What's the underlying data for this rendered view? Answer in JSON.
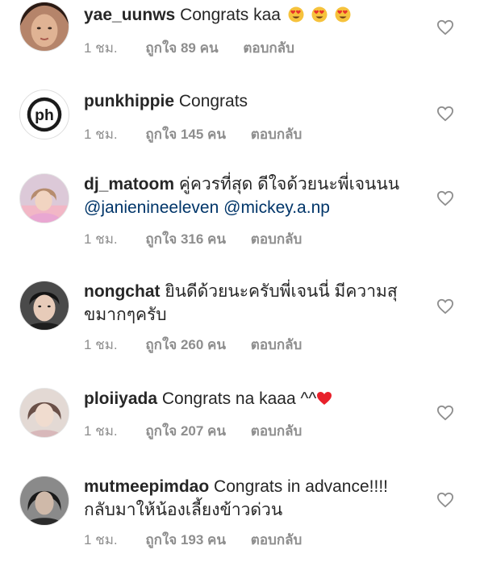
{
  "comments": [
    {
      "username": "yae_uunws",
      "text": "Congrats kaa",
      "emoji": [
        "heart-eyes-emoji",
        "heart-eyes-emoji",
        "heart-eyes-emoji"
      ],
      "time": "1 ชม.",
      "likes": "ถูกใจ 89 คน",
      "reply": "ตอบกลับ"
    },
    {
      "username": "punkhippie",
      "text": "Congrats",
      "avatar_text": "ph",
      "time": "1 ชม.",
      "likes": "ถูกใจ 145 คน",
      "reply": "ตอบกลับ"
    },
    {
      "username": "dj_matoom",
      "text": "คู่ควรที่สุด ดีใจด้วยนะพี่เจนนน",
      "mention1": "@janienineeleven",
      "mention2": "@mickey.a.np",
      "time": "1 ชม.",
      "likes": "ถูกใจ 316 คน",
      "reply": "ตอบกลับ"
    },
    {
      "username": "nongchat",
      "text": "ยินดีด้วยนะครับพี่เจนนี่ มีความสุ",
      "text2": "ขมากๆครับ",
      "time": "1 ชม.",
      "likes": "ถูกใจ 260 คน",
      "reply": "ตอบกลับ"
    },
    {
      "username": "ploiiyada",
      "text": "Congrats na kaaa ^^",
      "emoji": [
        "red-heart-emoji"
      ],
      "time": "1 ชม.",
      "likes": "ถูกใจ 207 คน",
      "reply": "ตอบกลับ"
    },
    {
      "username": "mutmeepimdao",
      "text": "Congrats in advance!!!!",
      "text2": "กลับมาให้น้องเลี้ยงข้าวด่วน",
      "time": "1 ชม.",
      "likes": "ถูกใจ 193 คน",
      "reply": "ตอบกลับ"
    }
  ],
  "colors": {
    "text": "#262626",
    "meta": "#8e8e8e",
    "mention": "#003569",
    "heart_outline": "#8e8e8e"
  }
}
